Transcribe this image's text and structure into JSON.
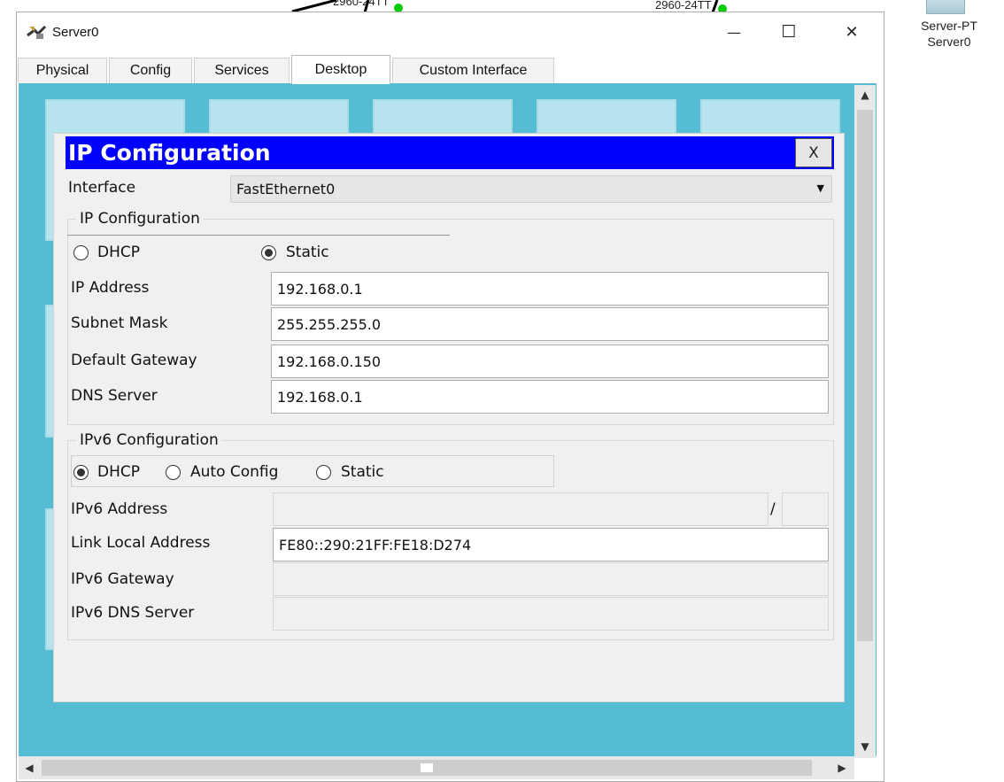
{
  "background": {
    "switch_label_left": "2960-24TT",
    "switch_label_right": "2960-24TT",
    "device_type": "Server-PT",
    "device_name": "Server0"
  },
  "window": {
    "title": "Server0",
    "controls": {
      "minimize": "—",
      "maximize": "☐",
      "close": "✕"
    },
    "tabs": [
      {
        "label": "Physical"
      },
      {
        "label": "Config"
      },
      {
        "label": "Services"
      },
      {
        "label": "Desktop",
        "active": true
      },
      {
        "label": "Custom Interface"
      }
    ]
  },
  "dialog": {
    "title": "IP Configuration",
    "close_label": "X",
    "interface_label": "Interface",
    "interface_value": "FastEthernet0",
    "ipv4": {
      "legend": "IP Configuration",
      "mode_options": [
        {
          "label": "DHCP",
          "selected": false
        },
        {
          "label": "Static",
          "selected": true
        }
      ],
      "fields": [
        {
          "label": "IP Address",
          "value": "192.168.0.1"
        },
        {
          "label": "Subnet Mask",
          "value": "255.255.255.0"
        },
        {
          "label": "Default Gateway",
          "value": "192.168.0.150"
        },
        {
          "label": "DNS Server",
          "value": "192.168.0.1"
        }
      ]
    },
    "ipv6": {
      "legend": "IPv6 Configuration",
      "mode_options": [
        {
          "label": "DHCP",
          "selected": true
        },
        {
          "label": "Auto Config",
          "selected": false
        },
        {
          "label": "Static",
          "selected": false
        }
      ],
      "address_label": "IPv6 Address",
      "address_value": "",
      "prefix_separator": "/",
      "prefix_value": "",
      "link_local_label": "Link Local Address",
      "link_local_value": "FE80::290:21FF:FE18:D274",
      "gateway_label": "IPv6 Gateway",
      "gateway_value": "",
      "dns_label": "IPv6 DNS Server",
      "dns_value": ""
    }
  },
  "colors": {
    "desktop_background": "#56bcd4",
    "dialog_header": "#0000ff"
  }
}
